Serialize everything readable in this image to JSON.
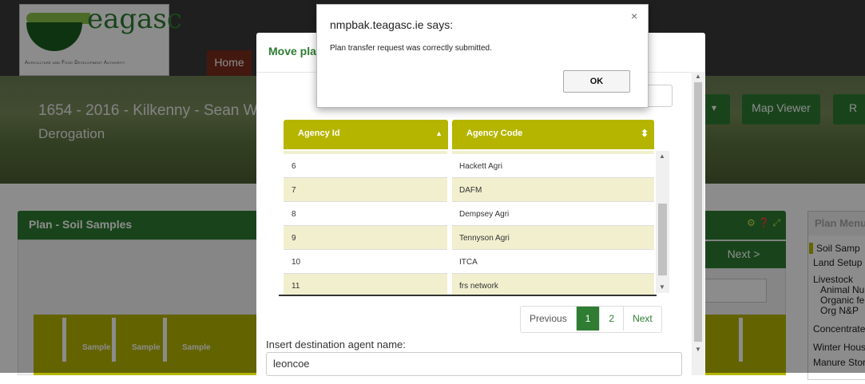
{
  "app": {
    "logo_word": "eagasc",
    "logo_sub": "Agriculture and Food Development Authority",
    "nav_home": "Home",
    "plan_title": "1654 - 2016 - Kilkenny - Sean Wh",
    "plan_sub": "Derogation",
    "map_viewer": "Map Viewer",
    "r_button": "R",
    "panel_title": "Plan - Soil Samples",
    "next_button": "Next >",
    "sample_headers": [
      "Sample",
      "Sample",
      "Sample"
    ],
    "plan_menu_title": "Plan Menu",
    "plan_menu_items": [
      "Soil Samp",
      "Land Setup",
      "Livestock",
      "Animal Nu",
      "Organic fe",
      "Org N&P",
      "Concentrate",
      "Winter Hous",
      "Manure Stor"
    ]
  },
  "modal": {
    "title": "Move pla",
    "columns": [
      "Agency Id",
      "Agency Code"
    ],
    "rows": [
      {
        "id": "6",
        "code": "Hackett Agri"
      },
      {
        "id": "7",
        "code": "DAFM"
      },
      {
        "id": "8",
        "code": "Dempsey Agri"
      },
      {
        "id": "9",
        "code": "Tennyson Agri"
      },
      {
        "id": "10",
        "code": "ITCA"
      },
      {
        "id": "11",
        "code": "frs network"
      }
    ],
    "pager": {
      "previous": "Previous",
      "page1": "1",
      "page2": "2",
      "next": "Next"
    },
    "dest_label": "Insert destination agent name:",
    "dest_value": "leoncoe"
  },
  "alert": {
    "title": "nmpbak.teagasc.ie says:",
    "message": "Plan transfer request was correctly submitted.",
    "ok": "OK",
    "close": "×"
  },
  "colors": {
    "brand_green": "#2e7d32",
    "table_header": "#b5b500",
    "row_alt": "#f1efce"
  }
}
